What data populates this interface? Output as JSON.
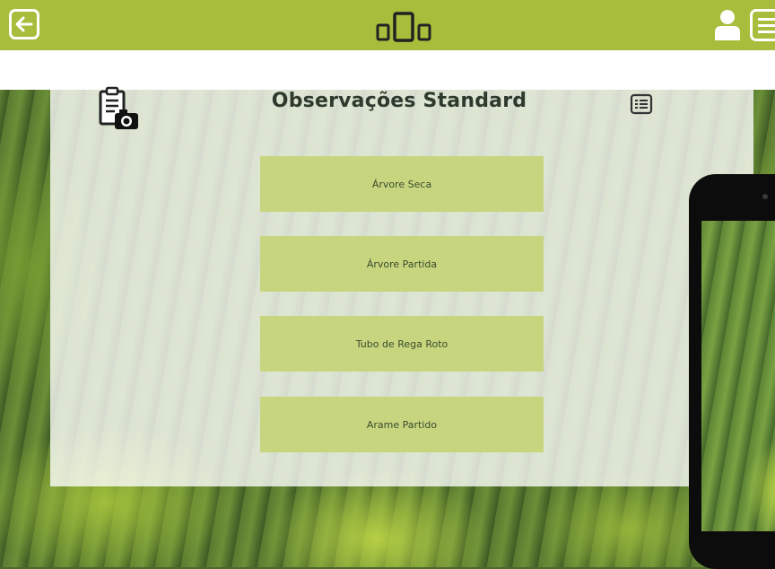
{
  "header": {
    "back_icon": "arrow-left-icon",
    "center_icon": "devices-icon",
    "user_icon": "user-icon",
    "menu_icon": "menu-icon"
  },
  "panel": {
    "title": "Observações Standard",
    "left_icon": "clipboard-camera-icon",
    "right_icon": "list-icon"
  },
  "observations": [
    {
      "label": "Árvore Seca"
    },
    {
      "label": "Árvore Partida"
    },
    {
      "label": "Tubo de Rega Roto"
    },
    {
      "label": "Arame Partido"
    }
  ],
  "colors": {
    "header_bg": "#a9bd3c",
    "button_bg": "#c7d67e",
    "title_text": "#2d3a2d"
  }
}
